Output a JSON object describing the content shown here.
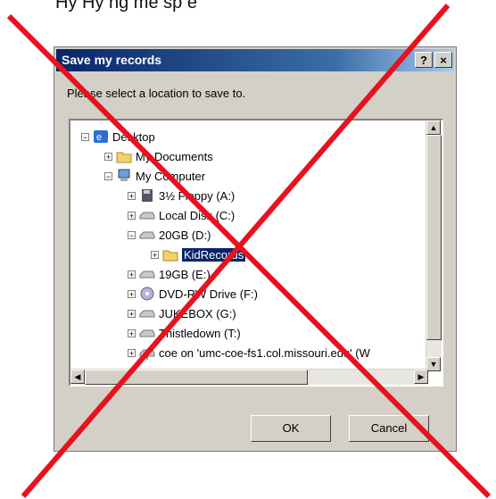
{
  "caption_top": "Hy   Hy   ng   me      sp   e",
  "dialog": {
    "title": "Save my records",
    "help_label": "?",
    "close_label": "×",
    "prompt": "Please select a location to save to.",
    "ok_label": "OK",
    "cancel_label": "Cancel"
  },
  "tree": {
    "items": [
      {
        "label": "Desktop",
        "icon": "desktop-icon",
        "expander": "−"
      },
      {
        "label": "My Documents",
        "icon": "folder-icon",
        "expander": "+"
      },
      {
        "label": "My Computer",
        "icon": "computer-icon",
        "expander": "−"
      },
      {
        "label": "3½ Floppy (A:)",
        "icon": "floppy-icon",
        "expander": "+"
      },
      {
        "label": "Local Disk (C:)",
        "icon": "drive-icon",
        "expander": "+"
      },
      {
        "label": "20GB (D:)",
        "icon": "drive-icon",
        "expander": "−"
      },
      {
        "label": "KidRecords",
        "icon": "folder-icon",
        "expander": "+",
        "selected": true
      },
      {
        "label": "19GB (E:)",
        "icon": "drive-icon",
        "expander": "+"
      },
      {
        "label": "DVD-RW Drive (F:)",
        "icon": "dvd-icon",
        "expander": "+"
      },
      {
        "label": "JUKEBOX (G:)",
        "icon": "drive-icon",
        "expander": "+"
      },
      {
        "label": "Thistledown (T:)",
        "icon": "drive-icon",
        "expander": "+"
      },
      {
        "label": "coe on 'umc-coe-fs1.col.missouri.edu' (W",
        "icon": "network-drive-icon",
        "expander": "+"
      }
    ]
  },
  "overlay": {
    "color": "#e8121e"
  }
}
